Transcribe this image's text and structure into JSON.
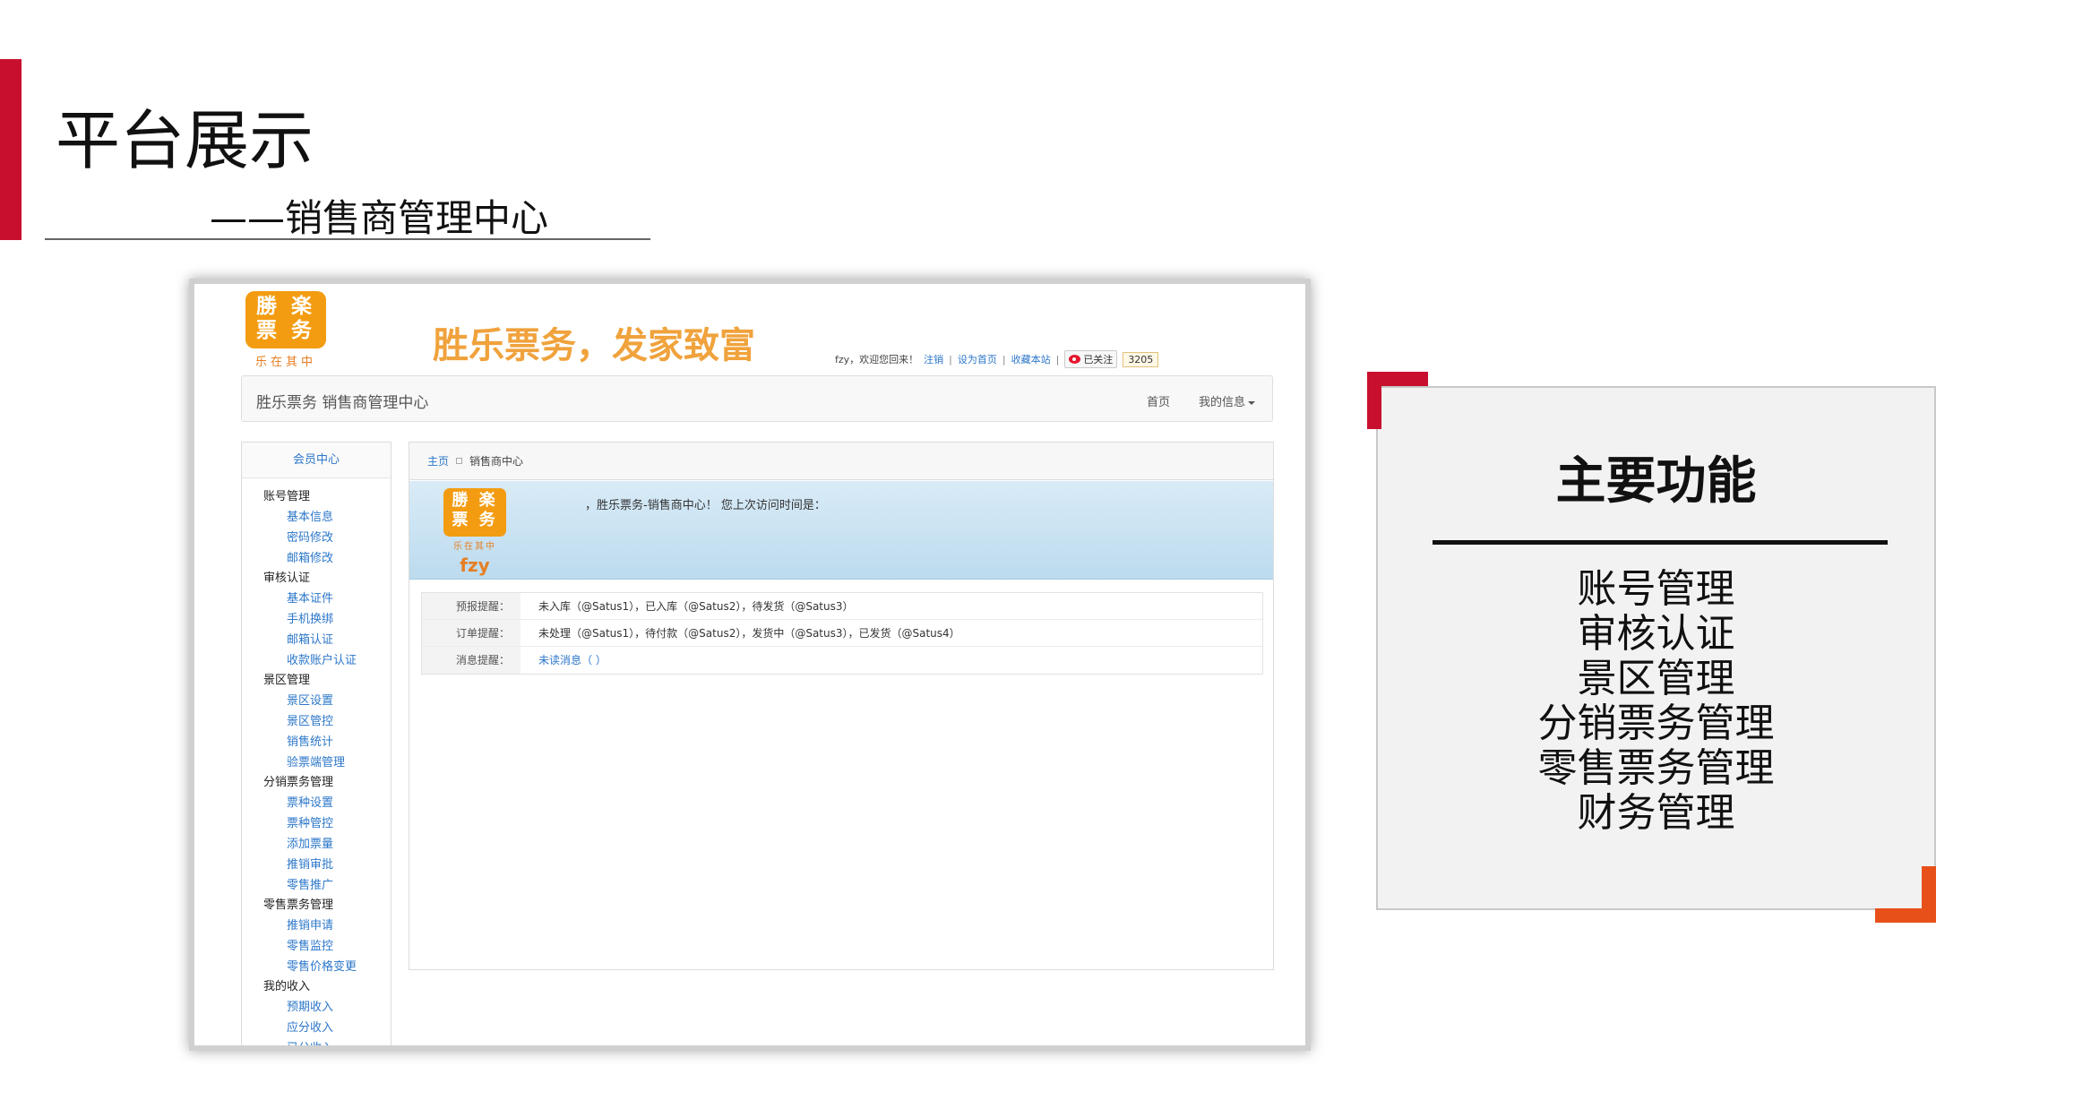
{
  "slide": {
    "title": "平台展示",
    "subtitle": "——销售商管理中心"
  },
  "site": {
    "logo_text": "勝 楽\n票 务",
    "logo_tagline": "乐在其中",
    "slogan": "胜乐票务，发家致富",
    "top_links": {
      "user_greeting": "fzy，欢迎您回来！",
      "logout": "注销",
      "set_home": "设为首页",
      "bookmark": "收藏本站",
      "follow": "已关注",
      "follow_count": "3205"
    },
    "navbar": {
      "brand": "胜乐票务 销售商管理中心",
      "home": "首页",
      "my_info": "我的信息"
    }
  },
  "sidebar": {
    "header": "会员中心",
    "groups": [
      {
        "title": "账号管理",
        "items": [
          "基本信息",
          "密码修改",
          "邮箱修改"
        ]
      },
      {
        "title": "审核认证",
        "items": [
          "基本证件",
          "手机换绑",
          "邮箱认证",
          "收款账户认证"
        ]
      },
      {
        "title": "景区管理",
        "items": [
          "景区设置",
          "景区管控",
          "销售统计",
          "验票端管理"
        ]
      },
      {
        "title": "分销票务管理",
        "items": [
          "票种设置",
          "票种管控",
          "添加票量",
          "推销审批",
          "零售推广"
        ]
      },
      {
        "title": "零售票务管理",
        "items": [
          "推销申请",
          "零售监控",
          "零售价格变更"
        ]
      },
      {
        "title": "我的收入",
        "items": [
          "预期收入",
          "应分收入",
          "已分收入"
        ]
      }
    ]
  },
  "main": {
    "breadcrumb": {
      "home": "主页",
      "current": "销售商中心"
    },
    "welcome": {
      "logo_text": "勝 楽\n票 务",
      "logo_tagline": "乐在其中",
      "username": "fzy",
      "message": "，胜乐票务-销售商中心！ 您上次访问时间是："
    },
    "notices": [
      {
        "label": "预报提醒：",
        "text": "未入库（@Satus1），已入库（@Satus2），待发货（@Satus3）"
      },
      {
        "label": "订单提醒：",
        "text": "未处理（@Satus1），待付款（@Satus2），发货中（@Satus3），已发货（@Satus4）"
      },
      {
        "label": "消息提醒：",
        "text": "未读消息（ ）"
      }
    ]
  },
  "card": {
    "title": "主要功能",
    "features": [
      "账号管理",
      "审核认证",
      "景区管理",
      "分销票务管理",
      "零售票务管理",
      "财务管理"
    ]
  },
  "colors": {
    "accent_red": "#c8102e",
    "accent_orange": "#e8501a",
    "brand_orange": "#f39c12",
    "link_blue": "#2c77c9"
  }
}
